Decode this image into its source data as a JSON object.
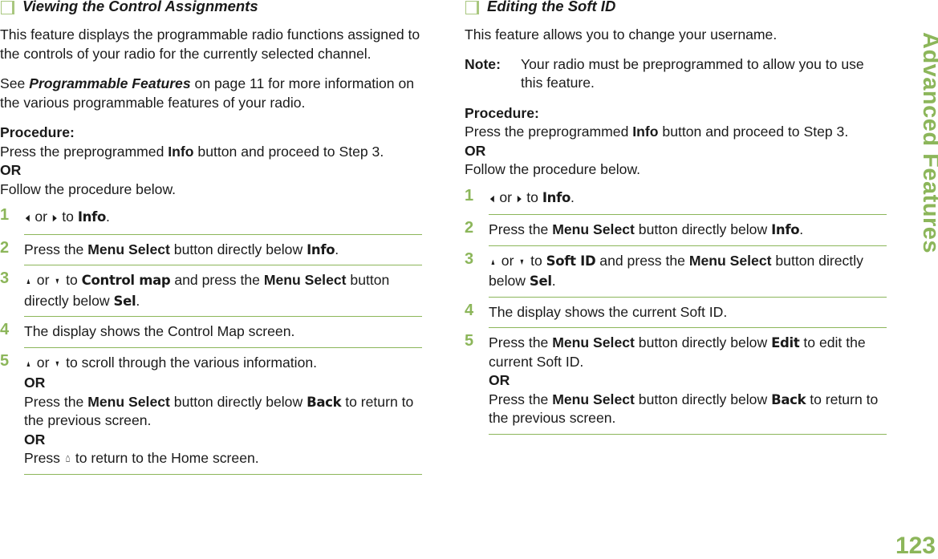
{
  "left": {
    "title": "Viewing the Control Assignments",
    "paragraphs": [
      [
        {
          "t": "This feature displays the programmable radio functions assigned to the controls of your radio for the currently selected channel."
        }
      ],
      [
        {
          "t": "See "
        },
        {
          "t": "Programmable Features",
          "s": "bi"
        },
        {
          "t": " on page 11 for more information on the various programmable features of your radio."
        }
      ]
    ],
    "procedure": [
      [
        {
          "t": "Procedure:",
          "s": "b"
        }
      ],
      [
        {
          "t": "Press the preprogrammed "
        },
        {
          "t": "Info",
          "s": "b"
        },
        {
          "t": " button and proceed to Step 3."
        }
      ],
      [
        {
          "t": "OR",
          "s": "b"
        }
      ],
      [
        {
          "t": "Follow the procedure below."
        }
      ]
    ],
    "steps": [
      {
        "num": "1",
        "lines": [
          [
            {
              "icon": "left-arrow"
            },
            {
              "t": " or "
            },
            {
              "icon": "right-arrow"
            },
            {
              "t": " to "
            },
            {
              "t": "Info",
              "s": "m"
            },
            {
              "t": "."
            }
          ]
        ]
      },
      {
        "num": "2",
        "lines": [
          [
            {
              "t": "Press the "
            },
            {
              "t": "Menu Select",
              "s": "b"
            },
            {
              "t": " button directly below "
            },
            {
              "t": "Info",
              "s": "m"
            },
            {
              "t": "."
            }
          ]
        ]
      },
      {
        "num": "3",
        "lines": [
          [
            {
              "icon": "up-arrow"
            },
            {
              "t": " or "
            },
            {
              "icon": "down-arrow"
            },
            {
              "t": " to "
            },
            {
              "t": "Control map",
              "s": "m"
            },
            {
              "t": " and press the "
            },
            {
              "t": "Menu Select",
              "s": "b"
            },
            {
              "t": " button directly below "
            },
            {
              "t": "Sel",
              "s": "m"
            },
            {
              "t": "."
            }
          ]
        ]
      },
      {
        "num": "4",
        "lines": [
          [
            {
              "t": "The display shows the Control Map screen."
            }
          ]
        ]
      },
      {
        "num": "5",
        "lines": [
          [
            {
              "icon": "up-arrow"
            },
            {
              "t": " or "
            },
            {
              "icon": "down-arrow"
            },
            {
              "t": " to scroll through the various information."
            }
          ],
          [
            {
              "t": "OR",
              "s": "b"
            }
          ],
          [
            {
              "t": "Press the "
            },
            {
              "t": "Menu Select",
              "s": "b"
            },
            {
              "t": " button directly below "
            },
            {
              "t": "Back",
              "s": "m"
            },
            {
              "t": " to return to the previous screen."
            }
          ],
          [
            {
              "t": "OR",
              "s": "b"
            }
          ],
          [
            {
              "t": "Press "
            },
            {
              "icon": "home"
            },
            {
              "t": " to return to the Home screen."
            }
          ]
        ]
      }
    ]
  },
  "right": {
    "title": "Editing the Soft ID",
    "paragraphs": [
      [
        {
          "t": "This feature allows you to change your username."
        }
      ]
    ],
    "note": {
      "label": "Note:",
      "text": "Your radio must be preprogrammed to allow you to use this feature."
    },
    "procedure": [
      [
        {
          "t": "Procedure:",
          "s": "b"
        }
      ],
      [
        {
          "t": "Press the preprogrammed "
        },
        {
          "t": "Info",
          "s": "b"
        },
        {
          "t": " button and proceed to Step 3."
        }
      ],
      [
        {
          "t": "OR",
          "s": "b"
        }
      ],
      [
        {
          "t": "Follow the procedure below."
        }
      ]
    ],
    "steps": [
      {
        "num": "1",
        "lines": [
          [
            {
              "icon": "left-arrow"
            },
            {
              "t": " or "
            },
            {
              "icon": "right-arrow"
            },
            {
              "t": " to "
            },
            {
              "t": "Info",
              "s": "m"
            },
            {
              "t": "."
            }
          ]
        ]
      },
      {
        "num": "2",
        "lines": [
          [
            {
              "t": "Press the "
            },
            {
              "t": "Menu Select",
              "s": "b"
            },
            {
              "t": " button directly below "
            },
            {
              "t": "Info",
              "s": "m"
            },
            {
              "t": "."
            }
          ]
        ]
      },
      {
        "num": "3",
        "lines": [
          [
            {
              "icon": "up-arrow"
            },
            {
              "t": " or "
            },
            {
              "icon": "down-arrow"
            },
            {
              "t": " to "
            },
            {
              "t": "Soft ID",
              "s": "m"
            },
            {
              "t": " and press the "
            },
            {
              "t": "Menu Select",
              "s": "b"
            },
            {
              "t": " button directly below "
            },
            {
              "t": "Sel",
              "s": "m"
            },
            {
              "t": "."
            }
          ]
        ]
      },
      {
        "num": "4",
        "lines": [
          [
            {
              "t": "The display shows the current Soft ID."
            }
          ]
        ]
      },
      {
        "num": "5",
        "lines": [
          [
            {
              "t": "Press the "
            },
            {
              "t": "Menu Select",
              "s": "b"
            },
            {
              "t": " button directly below "
            },
            {
              "t": "Edit",
              "s": "m"
            },
            {
              "t": " to edit the current Soft ID."
            }
          ],
          [
            {
              "t": "OR",
              "s": "b"
            }
          ],
          [
            {
              "t": "Press the "
            },
            {
              "t": "Menu Select",
              "s": "b"
            },
            {
              "t": " button directly below "
            },
            {
              "t": "Back",
              "s": "m"
            },
            {
              "t": " to return to the previous screen."
            }
          ]
        ]
      }
    ]
  },
  "side_title": "Advanced Features",
  "page_number": "123",
  "accent_color": "#8cb65a"
}
